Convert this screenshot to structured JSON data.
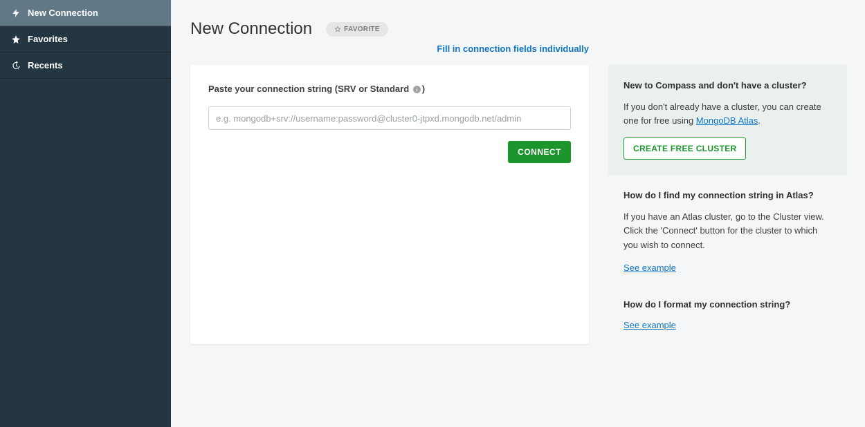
{
  "sidebar": {
    "items": [
      {
        "label": "New Connection"
      },
      {
        "label": "Favorites"
      },
      {
        "label": "Recents"
      }
    ]
  },
  "header": {
    "title": "New Connection",
    "favorite_label": "FAVORITE"
  },
  "individual_link": "Fill in connection fields individually",
  "connect_card": {
    "label_prefix": "Paste your connection string (SRV or Standard ",
    "label_suffix": ")",
    "placeholder": "e.g. mongodb+srv://username:password@cluster0-jtpxd.mongodb.net/admin",
    "connect_label": "CONNECT"
  },
  "aside": {
    "new_cluster": {
      "heading": "New to Compass and don't have a cluster?",
      "text_before": "If you don't already have a cluster, you can create one for free using ",
      "link": "MongoDB Atlas",
      "text_after": ".",
      "cta": "CREATE FREE CLUSTER"
    },
    "find_string": {
      "heading": "How do I find my connection string in Atlas?",
      "text": "If you have an Atlas cluster, go to the Cluster view. Click the 'Connect' button for the cluster to which you wish to connect.",
      "link": "See example"
    },
    "format_string": {
      "heading": "How do I format my connection string?",
      "link": "See example"
    }
  }
}
